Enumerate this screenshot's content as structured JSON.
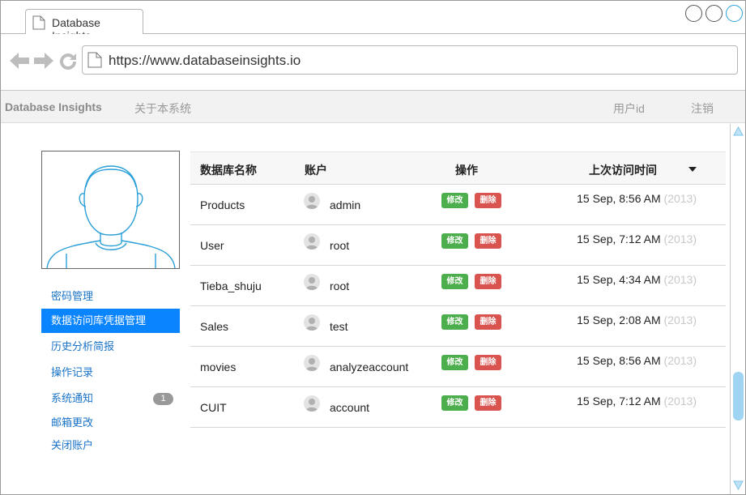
{
  "browser": {
    "tab_title": "Database Insights",
    "url": "https://www.databaseinsights.io"
  },
  "nav": {
    "brand": "Database Insights",
    "about": "关于本系统",
    "user": "用户id",
    "logout": "注销"
  },
  "sidebar": {
    "items": [
      {
        "label": "密码管理"
      },
      {
        "label": "数据访问库凭据管理"
      },
      {
        "label": "历史分析简报"
      },
      {
        "label": "操作记录"
      },
      {
        "label": "系统通知",
        "badge": "1"
      },
      {
        "label": "邮箱更改"
      },
      {
        "label": "关闭账户"
      }
    ],
    "active_index": 1
  },
  "table": {
    "headers": {
      "name": "数据库名称",
      "account": "账户",
      "actions": "操作",
      "last_access": "上次访问时间"
    },
    "edit_label": "修改",
    "delete_label": "删除",
    "rows": [
      {
        "name": "Products",
        "account": "admin",
        "time": "15 Sep, 8:56 AM",
        "year": "(2013)"
      },
      {
        "name": "User",
        "account": "root",
        "time": "15 Sep, 7:12 AM",
        "year": "(2013)"
      },
      {
        "name": "Tieba_shuju",
        "account": "root",
        "time": "15 Sep, 4:34 AM",
        "year": "(2013)"
      },
      {
        "name": "Sales",
        "account": "test",
        "time": "15 Sep, 2:08 AM",
        "year": "(2013)"
      },
      {
        "name": "movies",
        "account": "analyzeaccount",
        "time": "15 Sep, 8:56 AM",
        "year": "(2013)"
      },
      {
        "name": "CUIT",
        "account": "account",
        "time": "15 Sep, 7:12 AM",
        "year": "(2013)"
      }
    ]
  },
  "colors": {
    "accent": "#0a84ff",
    "edit_button": "#4cae4c",
    "delete_button": "#d9534f",
    "link": "#1a73c8"
  }
}
